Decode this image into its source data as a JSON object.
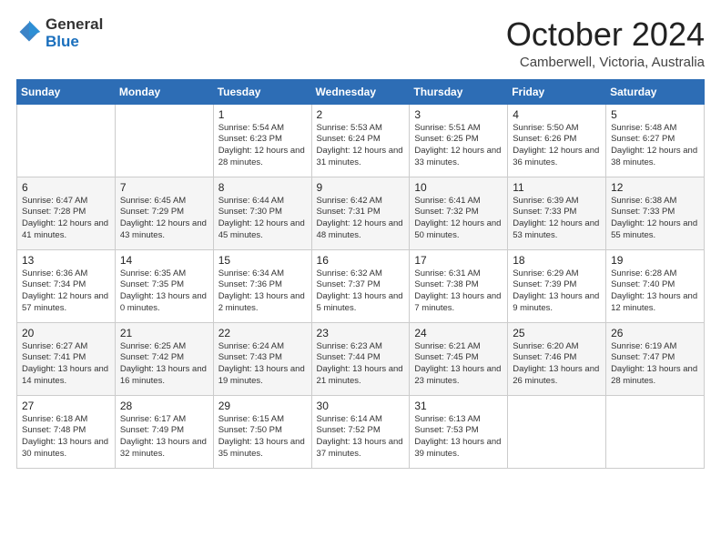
{
  "logo": {
    "general": "General",
    "blue": "Blue"
  },
  "header": {
    "month": "October 2024",
    "location": "Camberwell, Victoria, Australia"
  },
  "weekdays": [
    "Sunday",
    "Monday",
    "Tuesday",
    "Wednesday",
    "Thursday",
    "Friday",
    "Saturday"
  ],
  "weeks": [
    [
      {
        "day": "",
        "info": ""
      },
      {
        "day": "",
        "info": ""
      },
      {
        "day": "1",
        "info": "Sunrise: 5:54 AM\nSunset: 6:23 PM\nDaylight: 12 hours and 28 minutes."
      },
      {
        "day": "2",
        "info": "Sunrise: 5:53 AM\nSunset: 6:24 PM\nDaylight: 12 hours and 31 minutes."
      },
      {
        "day": "3",
        "info": "Sunrise: 5:51 AM\nSunset: 6:25 PM\nDaylight: 12 hours and 33 minutes."
      },
      {
        "day": "4",
        "info": "Sunrise: 5:50 AM\nSunset: 6:26 PM\nDaylight: 12 hours and 36 minutes."
      },
      {
        "day": "5",
        "info": "Sunrise: 5:48 AM\nSunset: 6:27 PM\nDaylight: 12 hours and 38 minutes."
      }
    ],
    [
      {
        "day": "6",
        "info": "Sunrise: 6:47 AM\nSunset: 7:28 PM\nDaylight: 12 hours and 41 minutes."
      },
      {
        "day": "7",
        "info": "Sunrise: 6:45 AM\nSunset: 7:29 PM\nDaylight: 12 hours and 43 minutes."
      },
      {
        "day": "8",
        "info": "Sunrise: 6:44 AM\nSunset: 7:30 PM\nDaylight: 12 hours and 45 minutes."
      },
      {
        "day": "9",
        "info": "Sunrise: 6:42 AM\nSunset: 7:31 PM\nDaylight: 12 hours and 48 minutes."
      },
      {
        "day": "10",
        "info": "Sunrise: 6:41 AM\nSunset: 7:32 PM\nDaylight: 12 hours and 50 minutes."
      },
      {
        "day": "11",
        "info": "Sunrise: 6:39 AM\nSunset: 7:33 PM\nDaylight: 12 hours and 53 minutes."
      },
      {
        "day": "12",
        "info": "Sunrise: 6:38 AM\nSunset: 7:33 PM\nDaylight: 12 hours and 55 minutes."
      }
    ],
    [
      {
        "day": "13",
        "info": "Sunrise: 6:36 AM\nSunset: 7:34 PM\nDaylight: 12 hours and 57 minutes."
      },
      {
        "day": "14",
        "info": "Sunrise: 6:35 AM\nSunset: 7:35 PM\nDaylight: 13 hours and 0 minutes."
      },
      {
        "day": "15",
        "info": "Sunrise: 6:34 AM\nSunset: 7:36 PM\nDaylight: 13 hours and 2 minutes."
      },
      {
        "day": "16",
        "info": "Sunrise: 6:32 AM\nSunset: 7:37 PM\nDaylight: 13 hours and 5 minutes."
      },
      {
        "day": "17",
        "info": "Sunrise: 6:31 AM\nSunset: 7:38 PM\nDaylight: 13 hours and 7 minutes."
      },
      {
        "day": "18",
        "info": "Sunrise: 6:29 AM\nSunset: 7:39 PM\nDaylight: 13 hours and 9 minutes."
      },
      {
        "day": "19",
        "info": "Sunrise: 6:28 AM\nSunset: 7:40 PM\nDaylight: 13 hours and 12 minutes."
      }
    ],
    [
      {
        "day": "20",
        "info": "Sunrise: 6:27 AM\nSunset: 7:41 PM\nDaylight: 13 hours and 14 minutes."
      },
      {
        "day": "21",
        "info": "Sunrise: 6:25 AM\nSunset: 7:42 PM\nDaylight: 13 hours and 16 minutes."
      },
      {
        "day": "22",
        "info": "Sunrise: 6:24 AM\nSunset: 7:43 PM\nDaylight: 13 hours and 19 minutes."
      },
      {
        "day": "23",
        "info": "Sunrise: 6:23 AM\nSunset: 7:44 PM\nDaylight: 13 hours and 21 minutes."
      },
      {
        "day": "24",
        "info": "Sunrise: 6:21 AM\nSunset: 7:45 PM\nDaylight: 13 hours and 23 minutes."
      },
      {
        "day": "25",
        "info": "Sunrise: 6:20 AM\nSunset: 7:46 PM\nDaylight: 13 hours and 26 minutes."
      },
      {
        "day": "26",
        "info": "Sunrise: 6:19 AM\nSunset: 7:47 PM\nDaylight: 13 hours and 28 minutes."
      }
    ],
    [
      {
        "day": "27",
        "info": "Sunrise: 6:18 AM\nSunset: 7:48 PM\nDaylight: 13 hours and 30 minutes."
      },
      {
        "day": "28",
        "info": "Sunrise: 6:17 AM\nSunset: 7:49 PM\nDaylight: 13 hours and 32 minutes."
      },
      {
        "day": "29",
        "info": "Sunrise: 6:15 AM\nSunset: 7:50 PM\nDaylight: 13 hours and 35 minutes."
      },
      {
        "day": "30",
        "info": "Sunrise: 6:14 AM\nSunset: 7:52 PM\nDaylight: 13 hours and 37 minutes."
      },
      {
        "day": "31",
        "info": "Sunrise: 6:13 AM\nSunset: 7:53 PM\nDaylight: 13 hours and 39 minutes."
      },
      {
        "day": "",
        "info": ""
      },
      {
        "day": "",
        "info": ""
      }
    ]
  ]
}
